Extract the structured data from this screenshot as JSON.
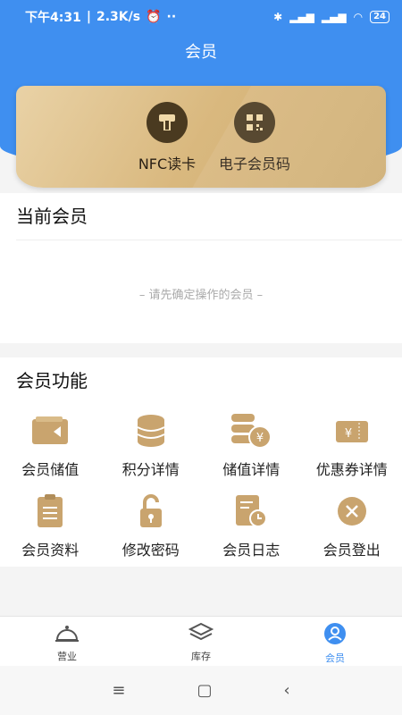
{
  "status": {
    "time": "下午4:31",
    "speed": "2.3K/s",
    "battery": "24"
  },
  "header": {
    "title": "会员"
  },
  "card": {
    "items": [
      {
        "label": "NFC读卡",
        "icon": "nfc-card-icon"
      },
      {
        "label": "电子会员码",
        "icon": "qr-code-icon"
      }
    ]
  },
  "current_member": {
    "title": "当前会员",
    "hint": "– 请先确定操作的会员 –"
  },
  "functions": {
    "title": "会员功能",
    "items": [
      {
        "label": "会员储值",
        "icon": "wallet-icon"
      },
      {
        "label": "积分详情",
        "icon": "coins-stack-icon"
      },
      {
        "label": "储值详情",
        "icon": "yen-coins-icon"
      },
      {
        "label": "优惠券详情",
        "icon": "coupon-icon"
      },
      {
        "label": "会员资料",
        "icon": "clipboard-icon"
      },
      {
        "label": "修改密码",
        "icon": "lock-icon"
      },
      {
        "label": "会员日志",
        "icon": "log-clock-icon"
      },
      {
        "label": "会员登出",
        "icon": "logout-x-icon"
      }
    ]
  },
  "bottom_nav": {
    "items": [
      {
        "label": "营业",
        "icon": "cloche-icon"
      },
      {
        "label": "库存",
        "icon": "layers-icon"
      },
      {
        "label": "会员",
        "icon": "user-icon",
        "active": true
      }
    ]
  },
  "colors": {
    "accent": "#3f8ff0",
    "gold": "#d6b27a",
    "icon_brown": "#c9a46e"
  }
}
